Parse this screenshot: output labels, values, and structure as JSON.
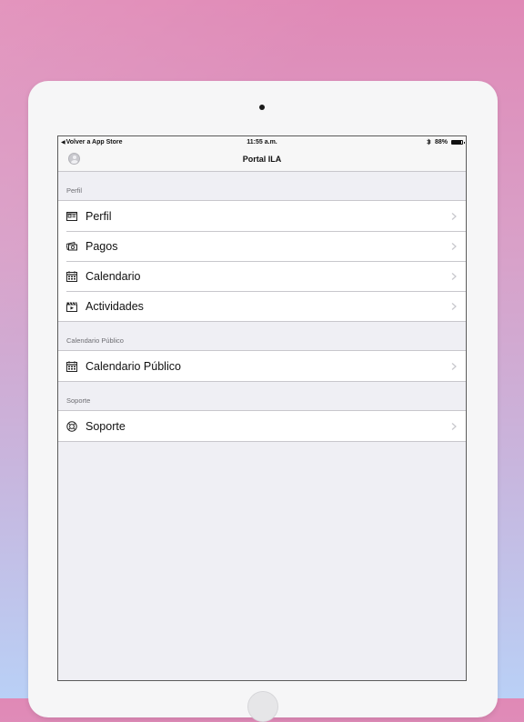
{
  "status_bar": {
    "back_label": "Volver a App Store",
    "time": "11:55 a.m.",
    "battery_text": "88%",
    "battery_level": 0.88
  },
  "nav_bar": {
    "title": "Portal ILA"
  },
  "sections": [
    {
      "header": "Perfil",
      "items": [
        {
          "label": "Perfil",
          "icon": "id-card-icon"
        },
        {
          "label": "Pagos",
          "icon": "money-icon"
        },
        {
          "label": "Calendario",
          "icon": "calendar-icon"
        },
        {
          "label": "Actividades",
          "icon": "clapperboard-icon"
        }
      ]
    },
    {
      "header": "Calendario Público",
      "items": [
        {
          "label": "Calendario Público",
          "icon": "calendar-icon"
        }
      ]
    },
    {
      "header": "Soporte",
      "items": [
        {
          "label": "Soporte",
          "icon": "lifebuoy-icon"
        }
      ]
    }
  ],
  "colors": {
    "separator": "#c8c7cc",
    "background": "#efeff4",
    "chevron": "#c7c7cc"
  }
}
